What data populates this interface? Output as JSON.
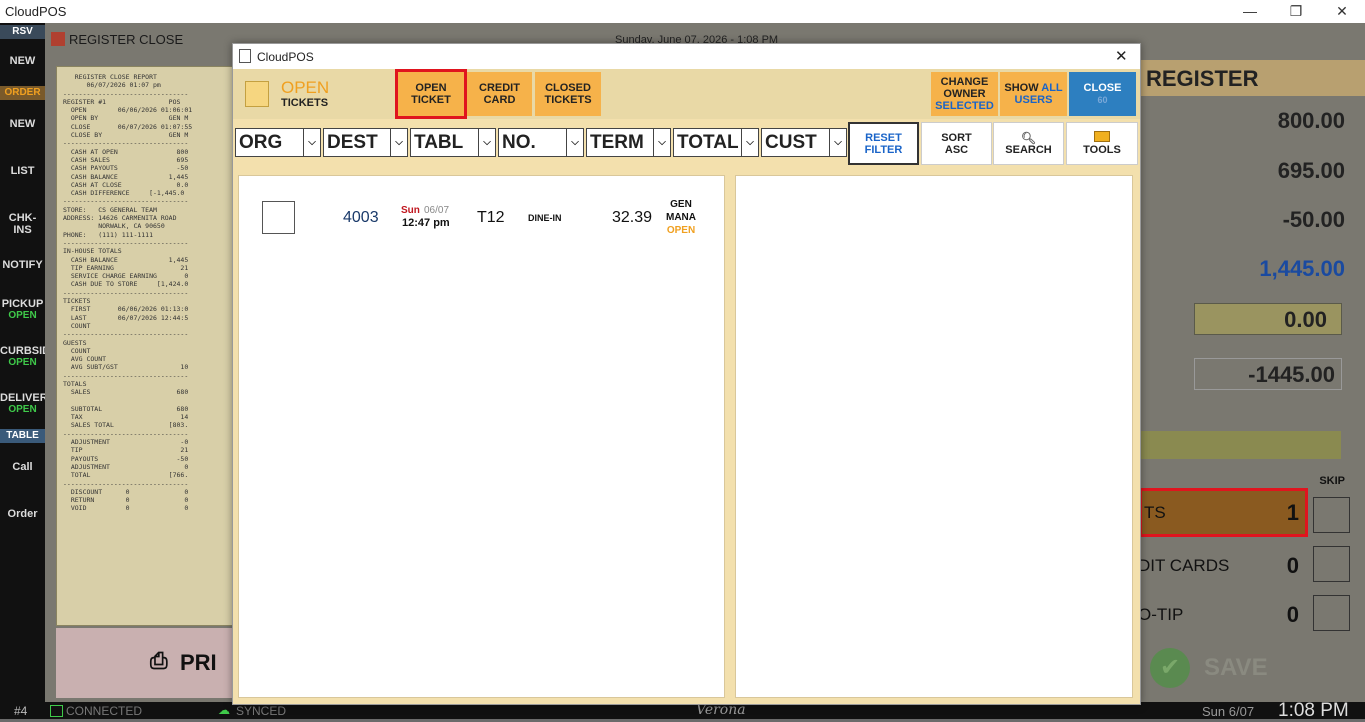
{
  "app_title": "CloudPOS",
  "window_controls": {
    "minimize": "—",
    "restore": "❐",
    "close": "✕"
  },
  "left_nav": [
    {
      "label": "RSV",
      "type": "header"
    },
    {
      "label": "NEW"
    },
    {
      "label": "ORDER",
      "type": "header-orange"
    },
    {
      "label": "NEW"
    },
    {
      "label": "LIST"
    },
    {
      "label": "CHK-INS"
    },
    {
      "label": "NOTIFY"
    },
    {
      "label": "PICKUP",
      "sub": "OPEN"
    },
    {
      "label": "CURBSID",
      "sub": "OPEN"
    },
    {
      "label": "DELIVER",
      "sub": "OPEN"
    },
    {
      "label": "TABLE",
      "type": "header-blue"
    },
    {
      "label": "Call"
    },
    {
      "label": "Order"
    }
  ],
  "background": {
    "title": "REGISTER CLOSE",
    "datetime": "Sunday, June 07, 2026 - 1:08 PM",
    "report_text": "   REGISTER CLOSE REPORT\n      06/07/2026 01:07 pm\n--------------------------------\nREGISTER #1                POS\n  OPEN        06/06/2026 01:06:01\n  OPEN BY                  GEN M\n  CLOSE       06/07/2026 01:07:55\n  CLOSE BY                 GEN M\n--------------------------------\n  CASH AT OPEN               800\n  CASH SALES                 695\n  CASH PAYOUTS               -50\n  CASH BALANCE             1,445\n  CASH AT CLOSE              0.0\n  CASH DIFFERENCE     [-1,445.0\n--------------------------------\nSTORE:   CS GENERAL TEAM\nADDRESS: 14626 CARMENITA ROAD\n         NORWALK, CA 90650\nPHONE:   (111) 111-1111\n--------------------------------\nIN-HOUSE TOTALS\n  CASH BALANCE             1,445\n  TIP EARNING                 21\n  SERVICE CHARGE EARNING       0\n  CASH DUE TO STORE     [1,424.0\n--------------------------------\nTICKETS\n  FIRST       06/06/2026 01:13:0\n  LAST        06/07/2026 12:44:5\n  COUNT\n--------------------------------\nGUESTS\n  COUNT\n  AVG COUNT\n  AVG SUBT/GST                10\n--------------------------------\nTOTALS\n  SALES                      680\n\n  SUBTOTAL                   680\n  TAX                         14\n  SALES TOTAL              [803.\n--------------------------------\n  ADJUSTMENT                  -0\n  TIP                         21\n  PAYOUTS                    -50\n  ADJUSTMENT                   0\n  TOTAL                    [766.\n--------------------------------\n  DISCOUNT      0              0\n  RETURN        0              0\n  VOID          0              0",
    "print_label": "PRI",
    "right_header": "REGISTER",
    "right_values": [
      "800.00",
      "695.00",
      "-50.00",
      "1,445.00",
      "0.00",
      "-1445.00"
    ],
    "skip_label": "SKIP",
    "rows": [
      {
        "label": "TS",
        "count": "1"
      },
      {
        "label": "DIT CARDS",
        "count": "0"
      },
      {
        "label": "O-TIP",
        "count": "0"
      }
    ],
    "save_label": "SAVE"
  },
  "status_bar": {
    "station": "#4",
    "connected": "CONNECTED",
    "synced": "SYNCED",
    "brand": "Verona",
    "date": "Sun 6/07",
    "time": "1:08 PM"
  },
  "dialog": {
    "title": "CloudPOS",
    "header_status": "OPEN",
    "header_sub": "TICKETS",
    "tabs": [
      {
        "line1": "OPEN",
        "line2": "TICKET"
      },
      {
        "line1": "CREDIT",
        "line2": "CARD"
      },
      {
        "line1": "CLOSED",
        "line2": "TICKETS"
      }
    ],
    "change_owner": {
      "line1": "CHANGE",
      "line2": "OWNER",
      "line3": "SELECTED"
    },
    "show_users": {
      "line1a": "SHOW",
      "line1b": "ALL",
      "line2": "USERS"
    },
    "close_btn": {
      "label": "CLOSE",
      "sub": "60"
    },
    "filters": [
      "ORG",
      "DEST",
      "TABL",
      "NO.",
      "TERM",
      "TOTAL",
      "CUST"
    ],
    "reset_filter": {
      "line1": "RESET",
      "line2": "FILTER"
    },
    "sort": {
      "line1": "SORT",
      "line2": "ASC"
    },
    "search_label": "SEARCH",
    "tools_label": "TOOLS",
    "tickets": [
      {
        "number": "4003",
        "day": "Sun",
        "date": "06/07",
        "time": "12:47 pm",
        "table": "T12",
        "type": "DINE-IN",
        "total": "32.39",
        "owner_line1": "GEN",
        "owner_line2": "MANA",
        "status": "OPEN"
      }
    ]
  },
  "colors": {
    "orange_button": "#f6b24a",
    "close_blue": "#2d7fc0",
    "selected_outline": "#e0141e",
    "open_text": "#f0a020",
    "day_red": "#c0161e",
    "link_blue": "#1a64c8",
    "synced_green": "#3fc94a"
  }
}
